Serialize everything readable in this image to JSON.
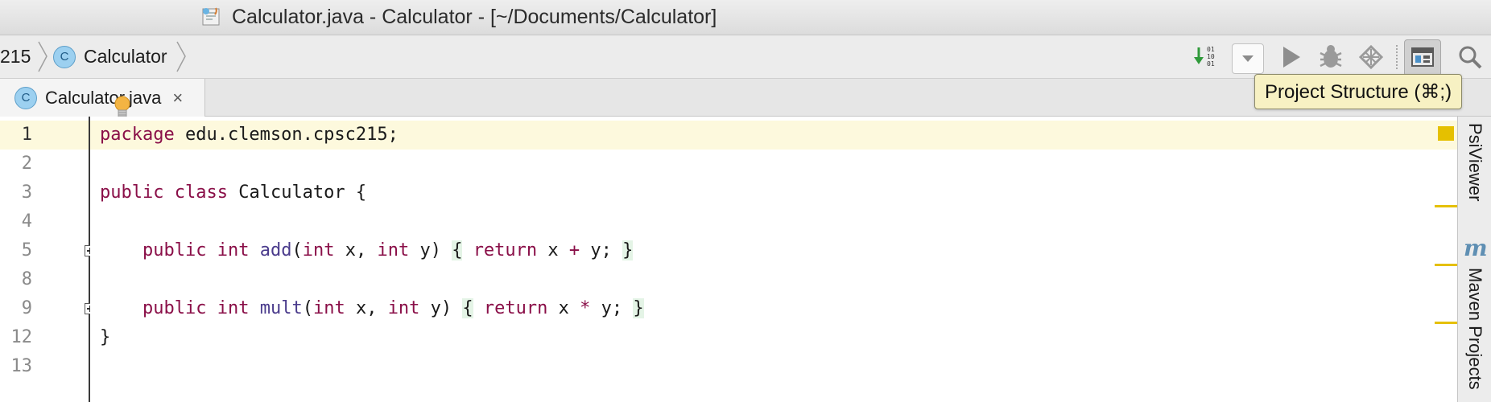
{
  "window": {
    "title": "Calculator.java - Calculator - [~/Documents/Calculator]"
  },
  "breadcrumb": {
    "items": [
      "215",
      "Calculator"
    ]
  },
  "toolbar": {
    "icons": [
      "run-configuration-icon",
      "dropdown-icon",
      "run-icon",
      "debug-icon",
      "coverage-icon",
      "project-structure-icon",
      "search-icon"
    ],
    "tooltip": "Project Structure (⌘;)"
  },
  "tabs": [
    {
      "label": "Calculator.java",
      "close": "×",
      "badge": "C"
    }
  ],
  "editor": {
    "lines": [
      {
        "number": "1",
        "current": true,
        "tokens": [
          [
            "kw",
            "package"
          ],
          [
            "t",
            " edu.clemson.cpsc215;"
          ]
        ]
      },
      {
        "number": "2",
        "tokens": []
      },
      {
        "number": "3",
        "tokens": [
          [
            "kw",
            "public"
          ],
          [
            "t",
            " "
          ],
          [
            "kw",
            "class"
          ],
          [
            "t",
            " Calculator {"
          ]
        ]
      },
      {
        "number": "4",
        "tokens": []
      },
      {
        "number": "5",
        "fold": true,
        "tokens": [
          [
            "t",
            "    "
          ],
          [
            "kw",
            "public"
          ],
          [
            "t",
            " "
          ],
          [
            "kw",
            "int"
          ],
          [
            "t",
            " "
          ],
          [
            "fn",
            "add"
          ],
          [
            "t",
            "("
          ],
          [
            "kw",
            "int"
          ],
          [
            "t",
            " x, "
          ],
          [
            "kw",
            "int"
          ],
          [
            "t",
            " y) "
          ],
          [
            "hl",
            "{"
          ],
          [
            "t",
            " "
          ],
          [
            "kw",
            "return"
          ],
          [
            "t",
            " x "
          ],
          [
            "op",
            "+"
          ],
          [
            "t",
            " y; "
          ],
          [
            "hl",
            "}"
          ]
        ]
      },
      {
        "number": "8",
        "tokens": []
      },
      {
        "number": "9",
        "fold": true,
        "tokens": [
          [
            "t",
            "    "
          ],
          [
            "kw",
            "public"
          ],
          [
            "t",
            " "
          ],
          [
            "kw",
            "int"
          ],
          [
            "t",
            " "
          ],
          [
            "fn",
            "mult"
          ],
          [
            "t",
            "("
          ],
          [
            "kw",
            "int"
          ],
          [
            "t",
            " x, "
          ],
          [
            "kw",
            "int"
          ],
          [
            "t",
            " y) "
          ],
          [
            "hl",
            "{"
          ],
          [
            "t",
            " "
          ],
          [
            "kw",
            "return"
          ],
          [
            "t",
            " x "
          ],
          [
            "op",
            "*"
          ],
          [
            "t",
            " y; "
          ],
          [
            "hl",
            "}"
          ]
        ]
      },
      {
        "number": "12",
        "tokens": [
          [
            "t",
            "}"
          ]
        ]
      },
      {
        "number": "13",
        "tokens": []
      }
    ]
  },
  "sidebar": {
    "items": [
      "PsiViewer",
      "Maven Projects"
    ],
    "maven_icon": "m"
  },
  "colors": {
    "keyword": "#8a0f48",
    "method": "#4a3b8c",
    "current_line": "#fdf9dd",
    "marker": "#e5c000",
    "tooltip_bg": "#f7f1c3"
  }
}
